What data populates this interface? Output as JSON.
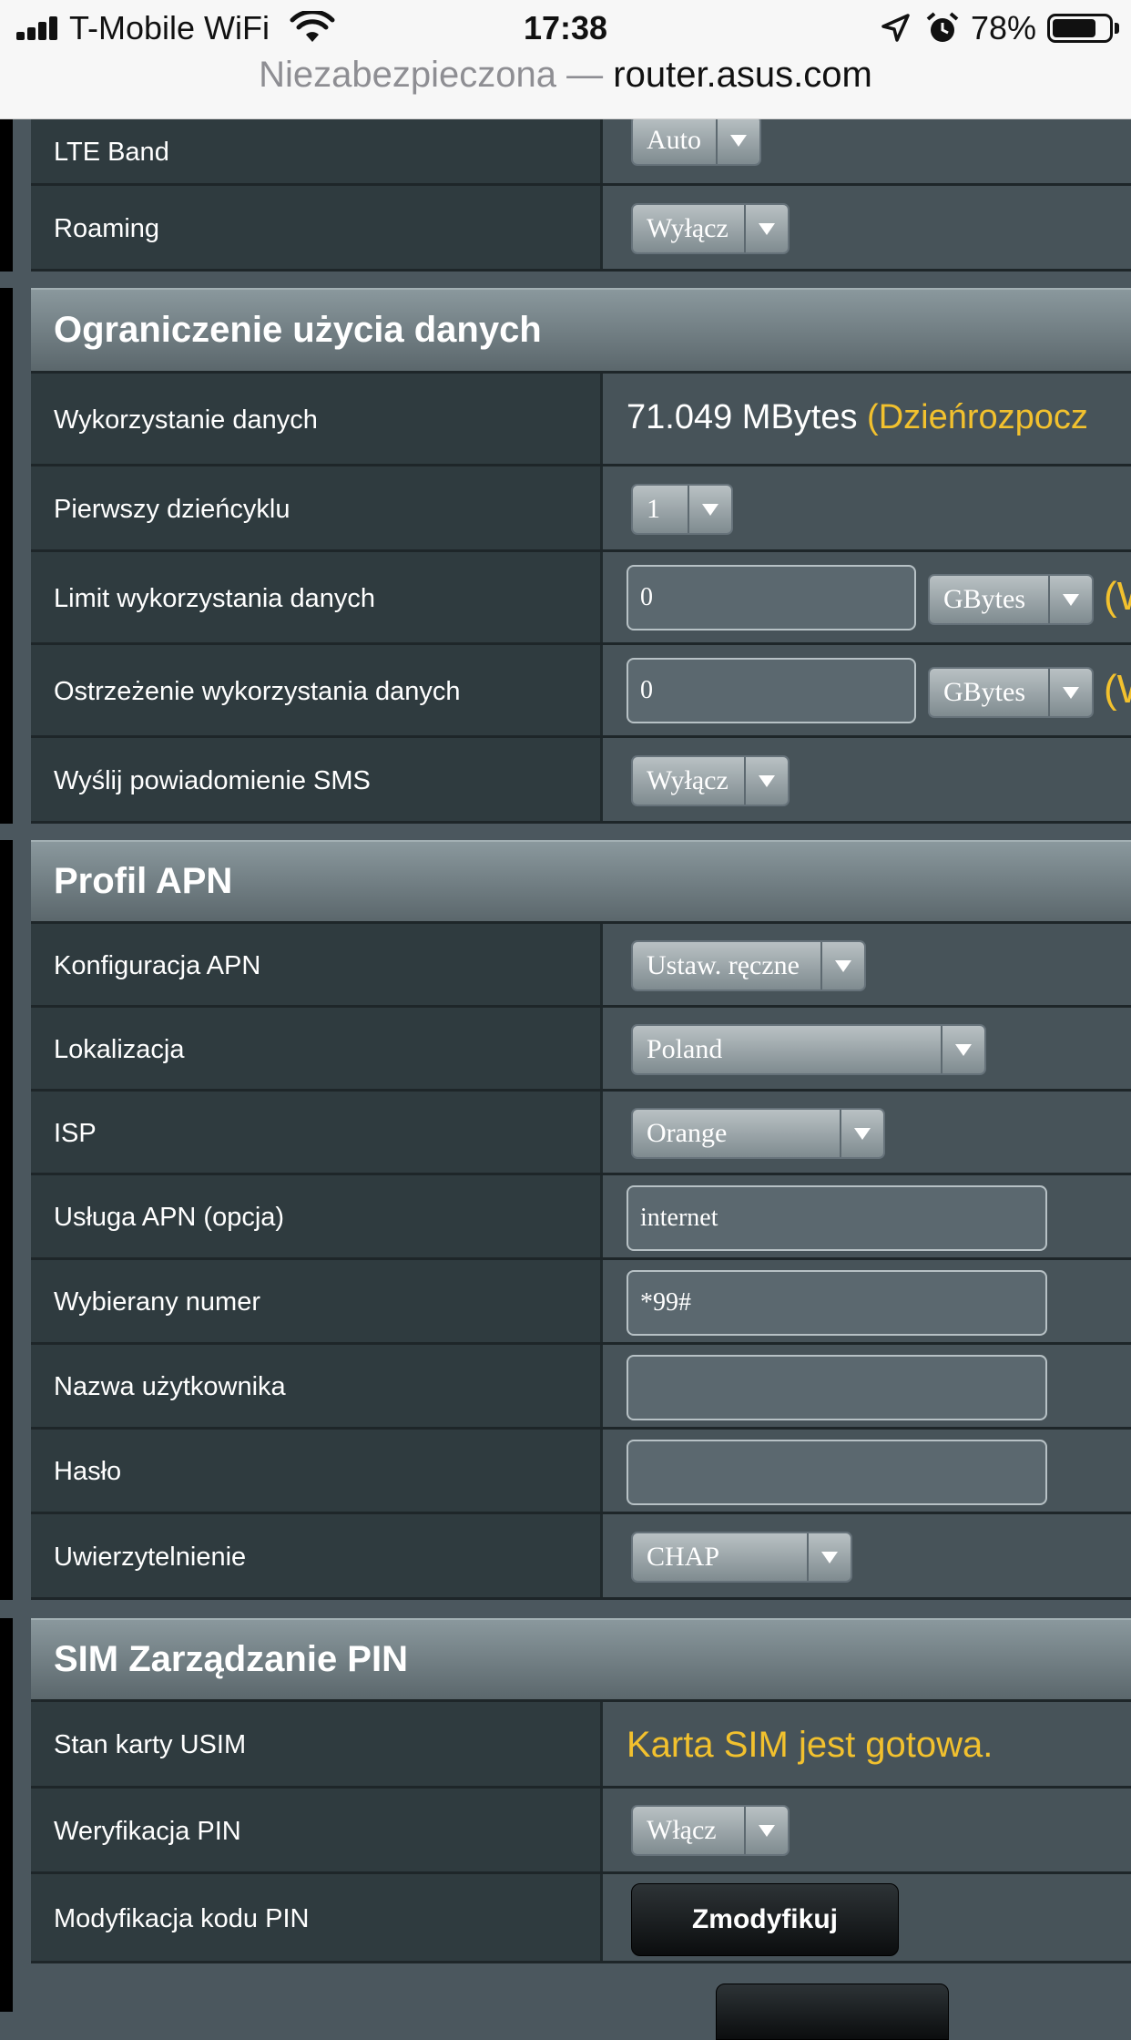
{
  "status_bar": {
    "carrier": "T-Mobile WiFi",
    "time": "17:38",
    "battery": "78%",
    "battery_level": 0.78
  },
  "url_bar": {
    "insecure_label": "Niezabezpieczona —",
    "host": "router.asus.com"
  },
  "top_rows": {
    "lte_band": {
      "label": "LTE Band",
      "value": "Auto"
    },
    "roaming": {
      "label": "Roaming",
      "value": "Wyłącz"
    }
  },
  "data_limit": {
    "title": "Ograniczenie użycia danych",
    "usage": {
      "label": "Wykorzystanie danych",
      "amount": "71.049 MBytes",
      "note": "(Dzieńrozpocz"
    },
    "first_day": {
      "label": "Pierwszy dzieńcyklu",
      "value": "1"
    },
    "limit": {
      "label": "Limit wykorzystania danych",
      "value": "0",
      "unit": "GBytes",
      "trail": "(W"
    },
    "warning": {
      "label": "Ostrzeżenie wykorzystania danych",
      "value": "0",
      "unit": "GBytes",
      "trail": "(W"
    },
    "sms": {
      "label": "Wyślij powiadomienie SMS",
      "value": "Wyłącz"
    }
  },
  "apn": {
    "title": "Profil APN",
    "config": {
      "label": "Konfiguracja APN",
      "value": "Ustaw. ręczne"
    },
    "location": {
      "label": "Lokalizacja",
      "value": "Poland"
    },
    "isp": {
      "label": "ISP",
      "value": "Orange"
    },
    "service": {
      "label": "Usługa APN (opcja)",
      "value": "internet"
    },
    "dial": {
      "label": "Wybierany numer",
      "value": "*99#"
    },
    "username": {
      "label": "Nazwa użytkownika",
      "value": ""
    },
    "password": {
      "label": "Hasło",
      "value": ""
    },
    "auth": {
      "label": "Uwierzytelnienie",
      "value": "CHAP"
    }
  },
  "sim": {
    "title": "SIM Zarządzanie PIN",
    "state": {
      "label": "Stan karty USIM",
      "value": "Karta SIM jest gotowa."
    },
    "pin_verify": {
      "label": "Weryfikacja PIN",
      "value": "Włącz"
    },
    "pin_modify": {
      "label": "Modyfikacja kodu PIN",
      "button": "Zmodyfikuj"
    }
  }
}
